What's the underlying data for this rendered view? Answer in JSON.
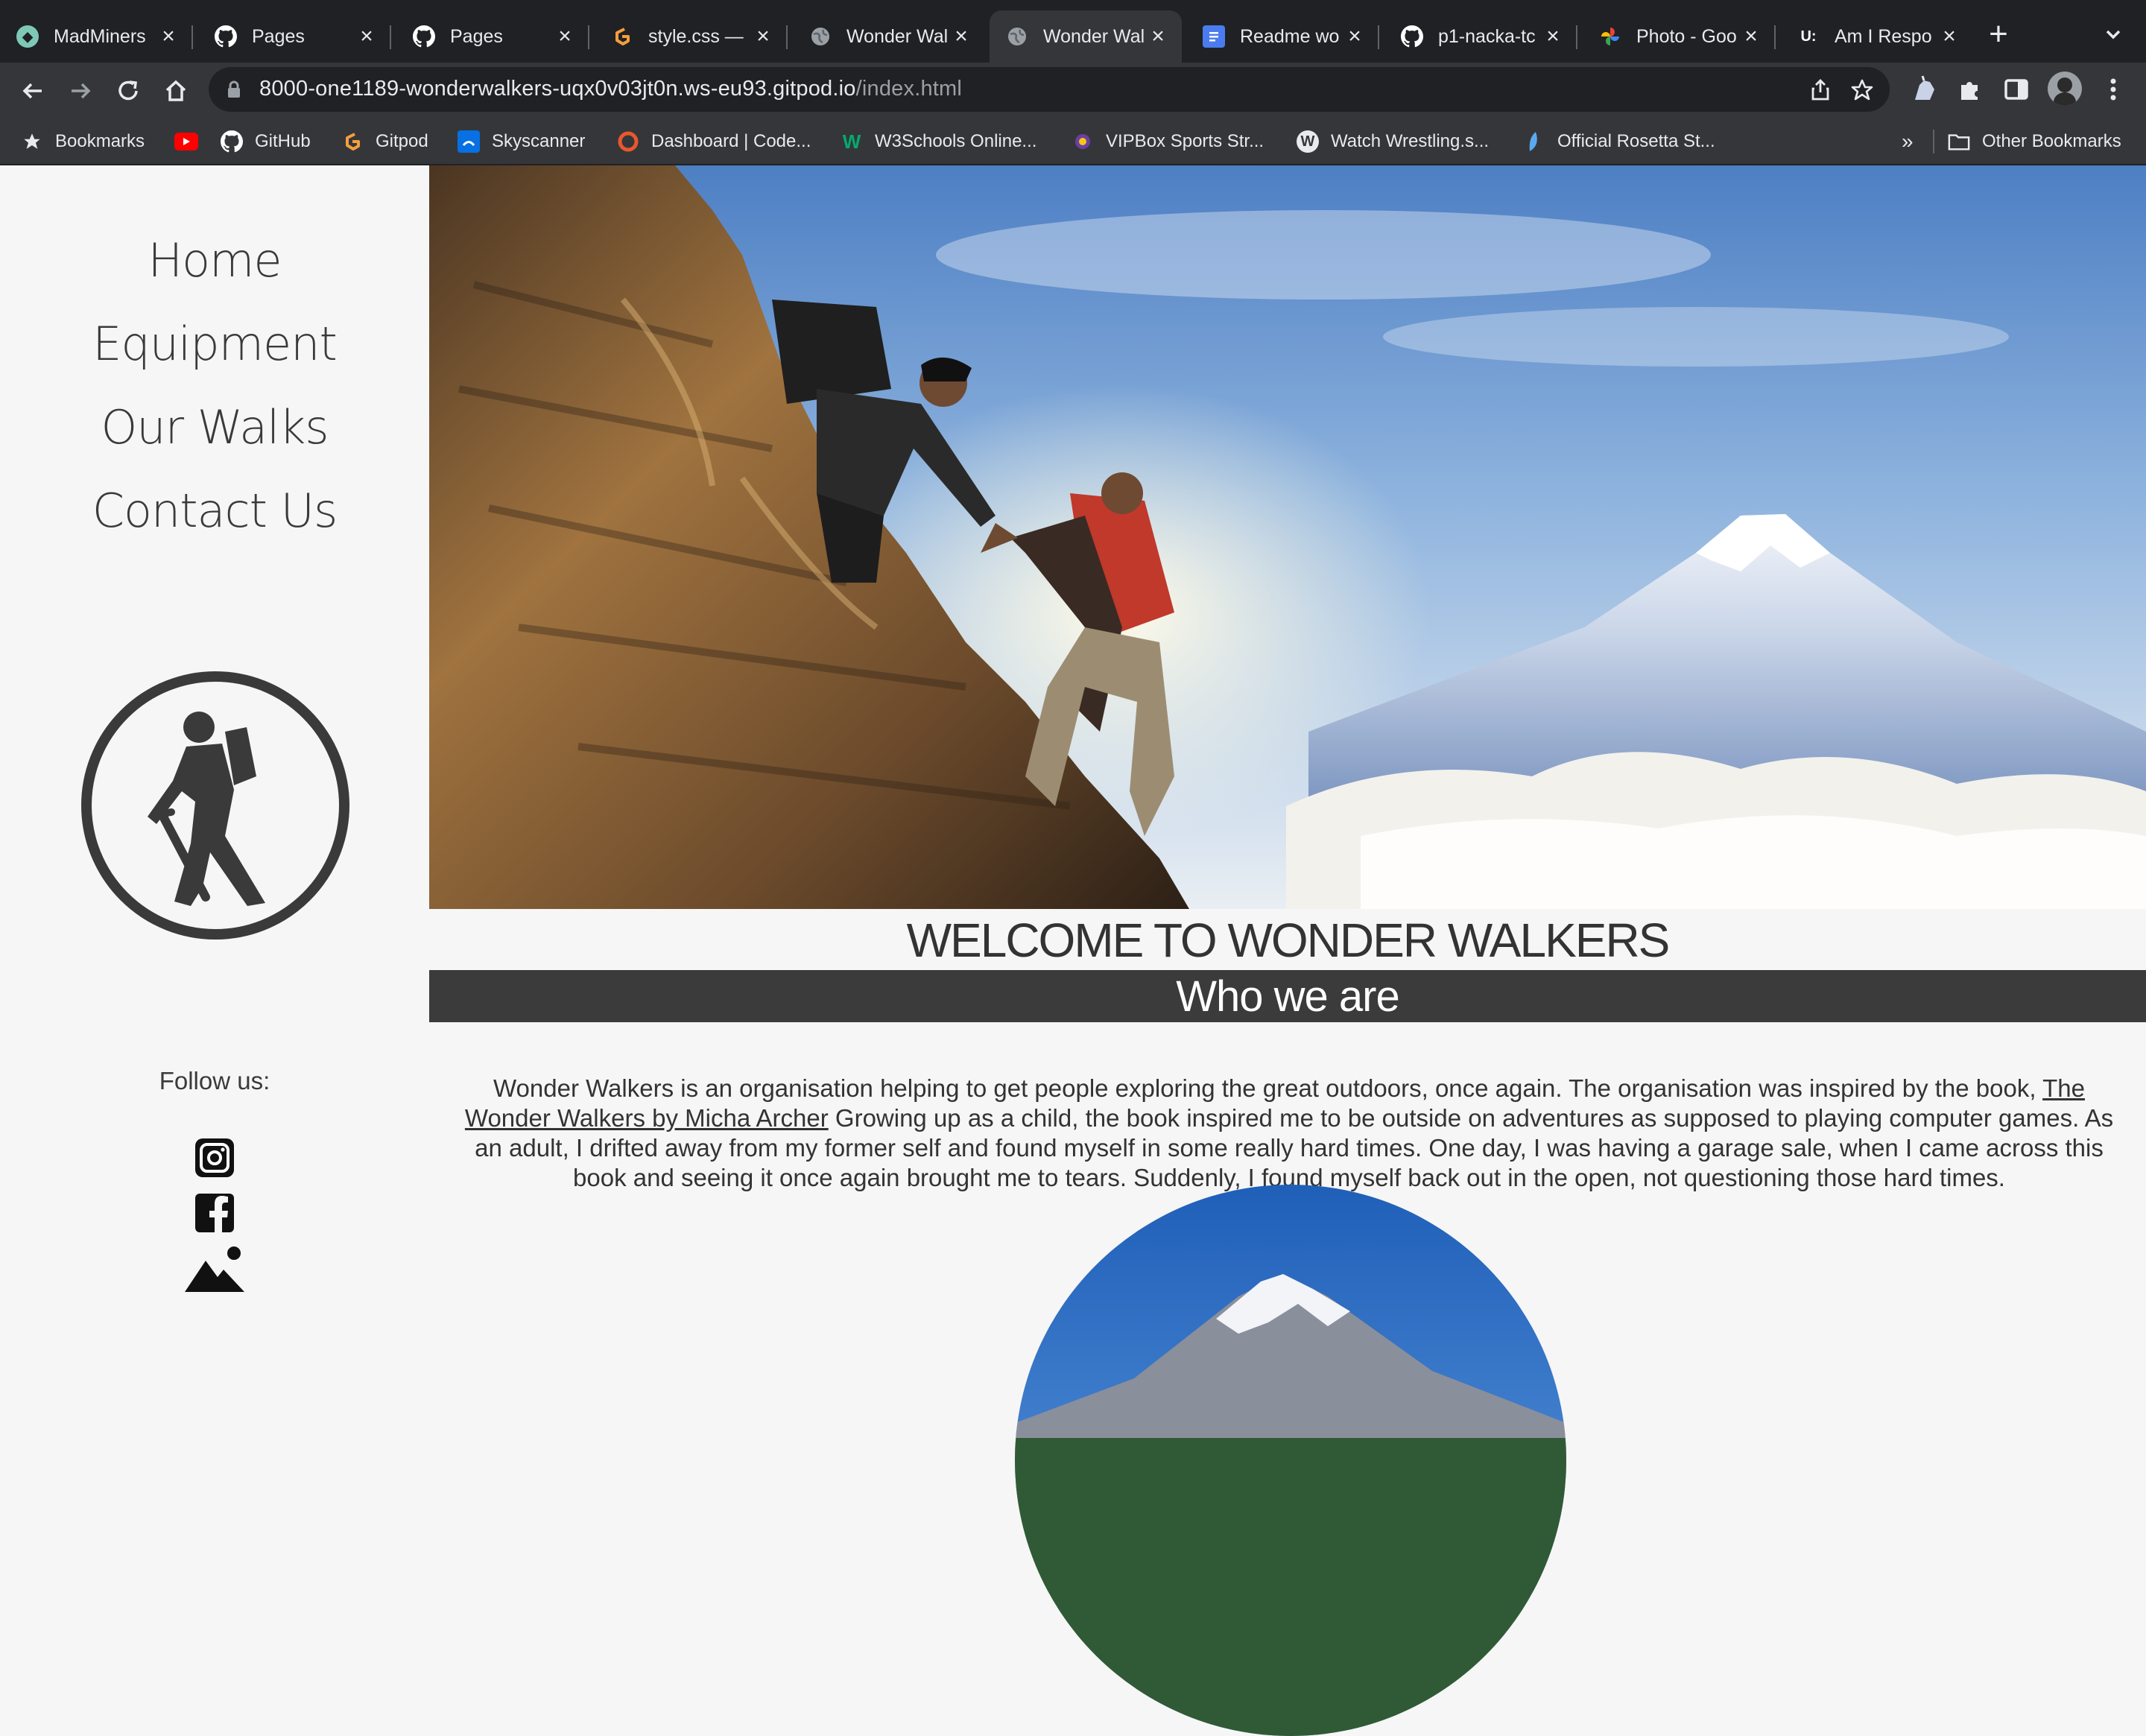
{
  "browser": {
    "tabs": [
      {
        "title": "MadMiners",
        "favicon": "madminers-icon",
        "color": "#7ec8b8"
      },
      {
        "title": "Pages",
        "favicon": "github-icon",
        "color": "#ffffff"
      },
      {
        "title": "Pages",
        "favicon": "github-icon",
        "color": "#ffffff"
      },
      {
        "title": "style.css —",
        "favicon": "gitpod-icon",
        "color": "#f59e3c"
      },
      {
        "title": "Wonder Wal",
        "favicon": "globe-icon",
        "color": "#9aa0a6"
      },
      {
        "title": "Wonder Wal",
        "favicon": "globe-icon",
        "color": "#9aa0a6"
      },
      {
        "title": "Readme wo",
        "favicon": "google-docs-icon",
        "color": "#4a7cf0"
      },
      {
        "title": "p1-nacka-tc",
        "favicon": "github-icon",
        "color": "#ffffff"
      },
      {
        "title": "Photo - Goo",
        "favicon": "google-photos-icon",
        "color": "#fbbc04"
      },
      {
        "title": "Am I Respo",
        "favicon": "ami-responsive-icon",
        "color": "#ffffff"
      }
    ],
    "active_tab": 5,
    "url_host": "8000-one1189-wonderwalkers-uqx0v03jt0n.ws-eu93.gitpod.io",
    "url_path": "/index.html",
    "bookmarks": [
      {
        "label": "Bookmarks",
        "icon": "star-icon"
      },
      {
        "label": "",
        "icon": "youtube-icon"
      },
      {
        "label": "GitHub",
        "icon": "github-icon"
      },
      {
        "label": "Gitpod",
        "icon": "gitpod-icon"
      },
      {
        "label": "Skyscanner",
        "icon": "skyscanner-icon"
      },
      {
        "label": "Dashboard | Code...",
        "icon": "codewars-icon"
      },
      {
        "label": "W3Schools Online...",
        "icon": "w3schools-icon"
      },
      {
        "label": "VIPBox Sports Str...",
        "icon": "vipbox-icon"
      },
      {
        "label": "Watch Wrestling.s...",
        "icon": "wordpress-icon"
      },
      {
        "label": "Official Rosetta St...",
        "icon": "rosetta-icon"
      }
    ],
    "overflow": "»",
    "other_bookmarks": "Other Bookmarks"
  },
  "nav": {
    "home": "Home",
    "equipment": "Equipment",
    "walks": "Our Walks",
    "contact": "Contact Us"
  },
  "sidebar": {
    "follow": "Follow us:",
    "social": [
      "instagram-icon",
      "facebook-icon",
      "mountain-icon"
    ]
  },
  "main": {
    "welcome": "WELCOME TO WONDER WALKERS",
    "who": "Who we are",
    "about_intro": "Wonder Walkers is an organisation helping to get people exploring the great outdoors, once again. The organisation was inspired by the book,",
    "about_link": "The Wonder Walkers by Micha Archer",
    "about_rest": "Growing up as a child, the book inspired me to be outside on adventures as supposed to playing computer games. As an adult, I drifted away from my former self and found myself in some really hard times. One day, I was having a garage sale, when I came across this book and seeing it once again brought me to tears. Suddenly, I found myself back out in the open, not questioning those hard times."
  },
  "colors": {
    "text": "#3a3a3a",
    "band": "#3b3b3b",
    "page_bg": "#f6f6f6"
  }
}
